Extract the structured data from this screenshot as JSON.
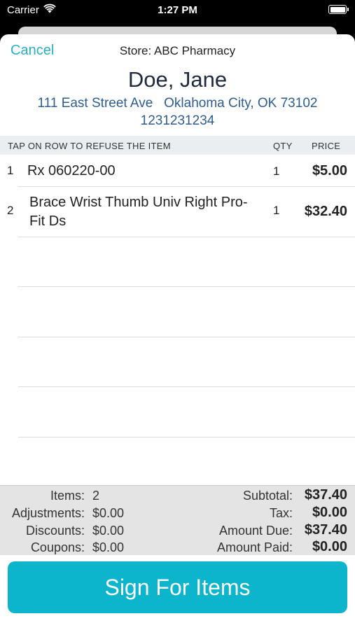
{
  "status_bar": {
    "carrier": "Carrier",
    "time": "1:27 PM"
  },
  "header": {
    "cancel_label": "Cancel",
    "store": "Store: ABC Pharmacy"
  },
  "customer": {
    "name": "Doe, Jane",
    "address": "111 East Street Ave   Oklahoma City, OK 73102",
    "phone": "1231231234"
  },
  "table": {
    "instruction": "TAP ON ROW TO REFUSE THE ITEM",
    "qty_header": "QTY",
    "price_header": "PRICE",
    "rows": [
      {
        "num": "1",
        "description": "Rx 060220-00",
        "qty": "1",
        "price": "$5.00"
      },
      {
        "num": "2",
        "description": "Brace Wrist Thumb Univ Right Pro-Fit Ds",
        "qty": "1",
        "price": "$32.40"
      }
    ]
  },
  "totals": {
    "items_label": "Items:",
    "items_value": "2",
    "adjustments_label": "Adjustments:",
    "adjustments_value": "$0.00",
    "discounts_label": "Discounts:",
    "discounts_value": "$0.00",
    "coupons_label": "Coupons:",
    "coupons_value": "$0.00",
    "subtotal_label": "Subtotal:",
    "subtotal_value": "$37.40",
    "tax_label": "Tax:",
    "tax_value": "$0.00",
    "amount_due_label": "Amount Due:",
    "amount_due_value": "$37.40",
    "amount_paid_label": "Amount Paid:",
    "amount_paid_value": "$0.00"
  },
  "sign_button_label": "Sign For Items",
  "colors": {
    "accent": "#0db5cc",
    "link": "#2ab0c6",
    "address": "#2d5d92"
  }
}
